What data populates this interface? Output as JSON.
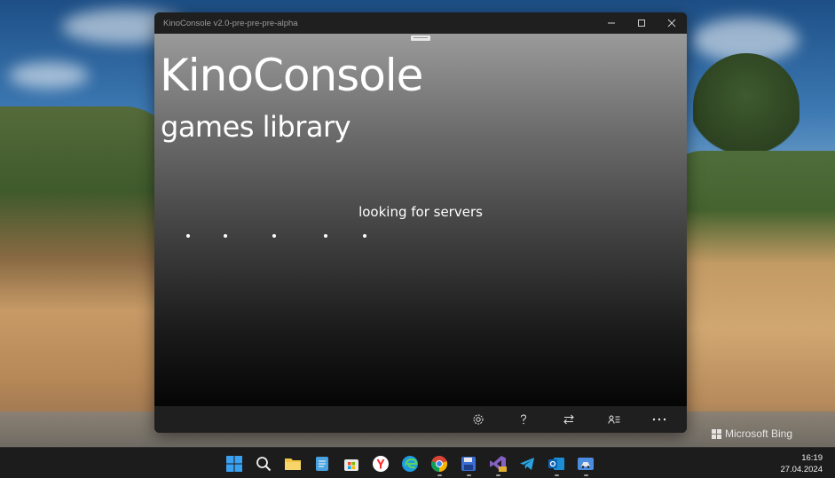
{
  "window": {
    "title": "KinoConsole v2.0-pre-pre-pre-alpha",
    "controls": [
      "minimize-icon",
      "maximize-icon",
      "close-icon"
    ]
  },
  "app": {
    "title": "KinoConsole",
    "subtitle": "games library",
    "status": "looking for servers",
    "appbar_icons": [
      "settings-icon",
      "help-icon",
      "switch-icon",
      "account-list-icon",
      "more-icon"
    ]
  },
  "wallpaper": {
    "watermark": "Microsoft Bing"
  },
  "taskbar": {
    "icons": [
      "windows-start-icon",
      "search-icon",
      "file-explorer-icon",
      "notepad-icon",
      "microsoft-store-icon",
      "yandex-browser-icon",
      "edge-icon",
      "chrome-icon",
      "save-app-icon",
      "visual-studio-icon",
      "telegram-icon",
      "outlook-icon",
      "remote-desktop-icon"
    ],
    "time": "16:19",
    "date": "27.04.2024"
  },
  "colors": {
    "titlebar": "#1f1f1f",
    "appbar": "#1f1f1f",
    "taskbar": "#1c1c1c",
    "accent_blue": "#0a84d8"
  }
}
